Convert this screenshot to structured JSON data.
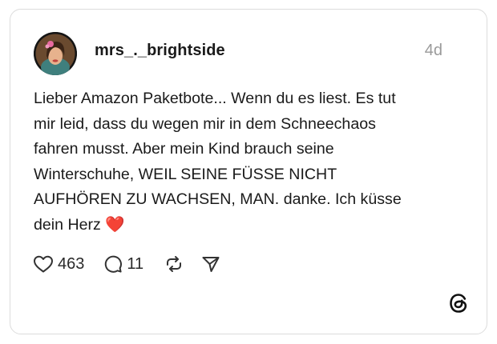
{
  "post": {
    "username": "mrs_._brightside",
    "timestamp": "4d",
    "text_lines": [
      "Lieber Amazon Paketbote... Wenn du es liest. Es tut",
      "mir leid, dass du wegen mir in dem Schneechaos",
      "fahren musst. Aber mein Kind brauch seine",
      "Winterschuhe, WEIL SEINE FÜSSE NICHT",
      "AUFHÖREN ZU WACHSEN, MAN. danke. Ich küsse",
      "dein Herz"
    ],
    "emoji": "❤️"
  },
  "actions": {
    "like_icon": "heart-outline-icon",
    "like_count": "463",
    "reply_icon": "speech-bubble-icon",
    "reply_count": "11",
    "repost_icon": "repost-icon",
    "share_icon": "send-icon"
  },
  "branding": {
    "logo_icon": "threads-logo-icon"
  },
  "colors": {
    "text": "#1a1a1a",
    "muted": "#9a9a9a",
    "border": "#dcdcdc",
    "heart": "#e0245e"
  }
}
